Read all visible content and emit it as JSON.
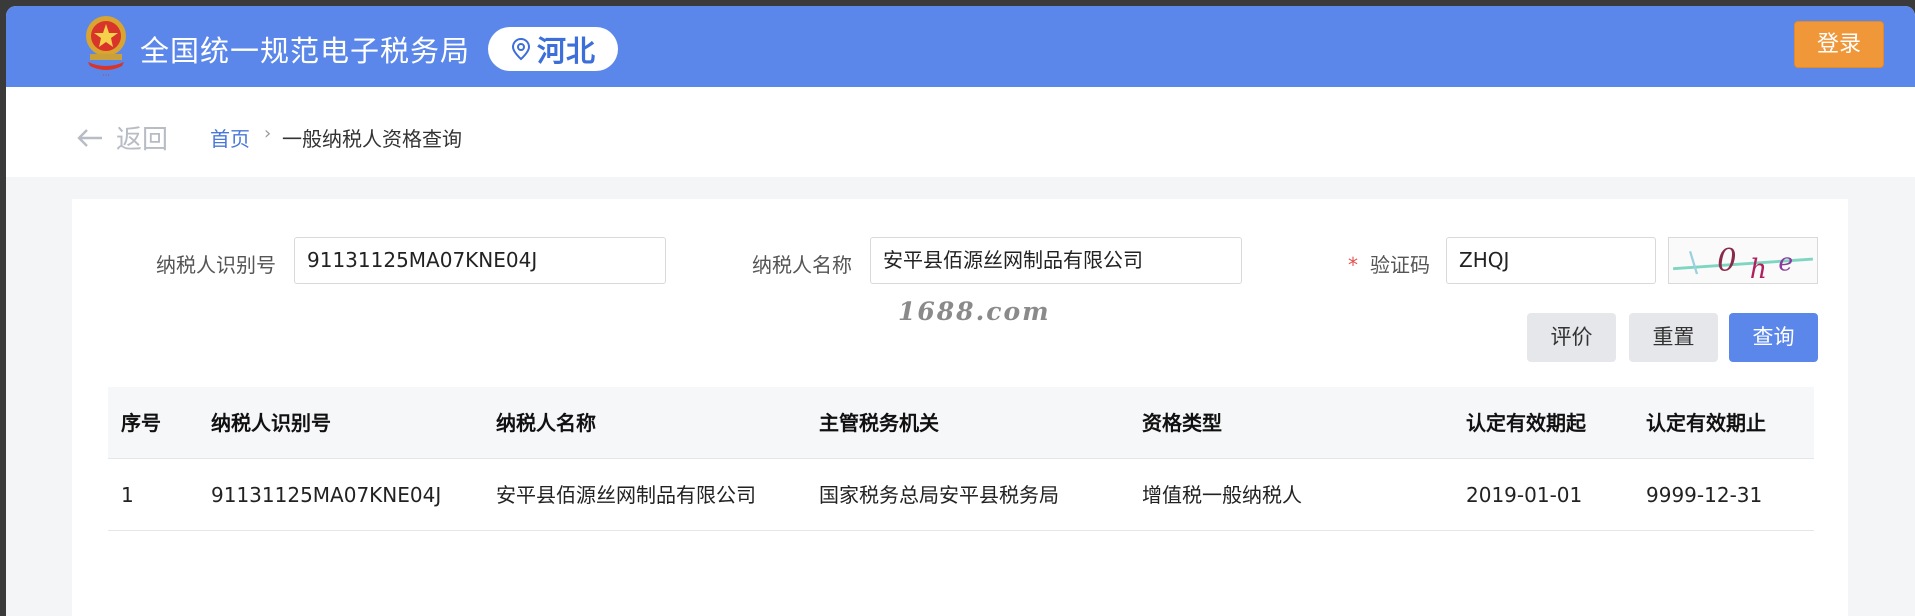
{
  "header": {
    "site_title": "全国统一规范电子税务局",
    "region": "河北",
    "login_label": "登录"
  },
  "nav": {
    "back_label": "返回",
    "breadcrumb_home": "首页",
    "breadcrumb_sep": "›",
    "breadcrumb_current": "一般纳税人资格查询"
  },
  "form": {
    "taxpayer_id_label": "纳税人识别号",
    "taxpayer_id_value": "91131125MA07KNE04J",
    "taxpayer_name_label": "纳税人名称",
    "taxpayer_name_value": "安平县佰源丝网制品有限公司",
    "captcha_required_mark": "*",
    "captcha_label": "验证码",
    "captcha_value": "ZHQJ",
    "captcha_image_text": "Vohe"
  },
  "watermark": "1688.com",
  "buttons": {
    "evaluate": "评价",
    "reset": "重置",
    "query": "查询"
  },
  "table": {
    "headers": [
      "序号",
      "纳税人识别号",
      "纳税人名称",
      "主管税务机关",
      "资格类型",
      "认定有效期起",
      "认定有效期止"
    ],
    "rows": [
      [
        "1",
        "91131125MA07KNE04J",
        "安平县佰源丝网制品有限公司",
        "国家税务总局安平县税务局",
        "增值税一般纳税人",
        "2019-01-01",
        "9999-12-31"
      ]
    ]
  },
  "colors": {
    "header_bg": "#5b87ea",
    "login_button": "#f0973a",
    "link_blue": "#4a78d8",
    "query_button": "#5b87ea"
  }
}
